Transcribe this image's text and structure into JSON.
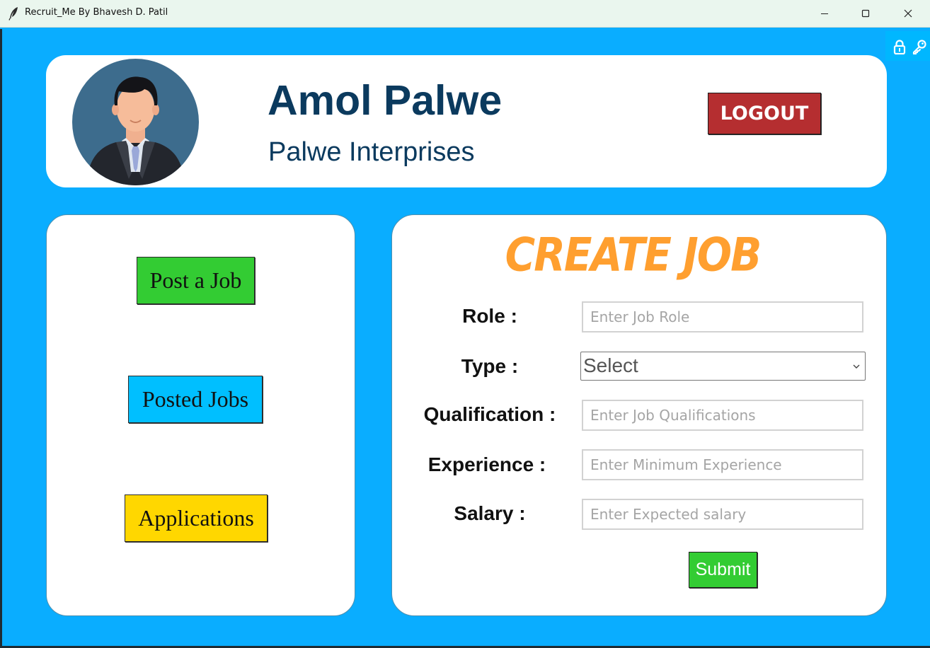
{
  "window": {
    "title": "Recruit_Me By Bhavesh D. Patil",
    "icon": "feather-icon"
  },
  "colors": {
    "background": "#0aadff",
    "name_text": "#0b3a5e",
    "logout": "#b52e30",
    "post_job": "#33cc33",
    "posted_jobs": "#00bfff",
    "applications": "#ffd700",
    "title_orange": "#ff9f2f",
    "submit": "#33cc33"
  },
  "header": {
    "user_name": "Amol Palwe",
    "company": "Palwe Interprises",
    "logout_label": "LOGOUT",
    "avatar_icon": "businessman-avatar-icon"
  },
  "menu": {
    "post_job": "Post a Job",
    "posted_jobs": "Posted Jobs",
    "applications": "Applications"
  },
  "form": {
    "title": "CREATE JOB",
    "fields": {
      "role": {
        "label": "Role :",
        "placeholder": "Enter Job Role"
      },
      "type": {
        "label": "Type :",
        "selected": "Select"
      },
      "qualification": {
        "label": "Qualification :",
        "placeholder": "Enter Job Qualifications"
      },
      "experience": {
        "label": "Experience :",
        "placeholder": "Enter Minimum Experience"
      },
      "salary": {
        "label": "Salary :",
        "placeholder": "Enter Expected salary"
      }
    },
    "submit_label": "Submit"
  }
}
